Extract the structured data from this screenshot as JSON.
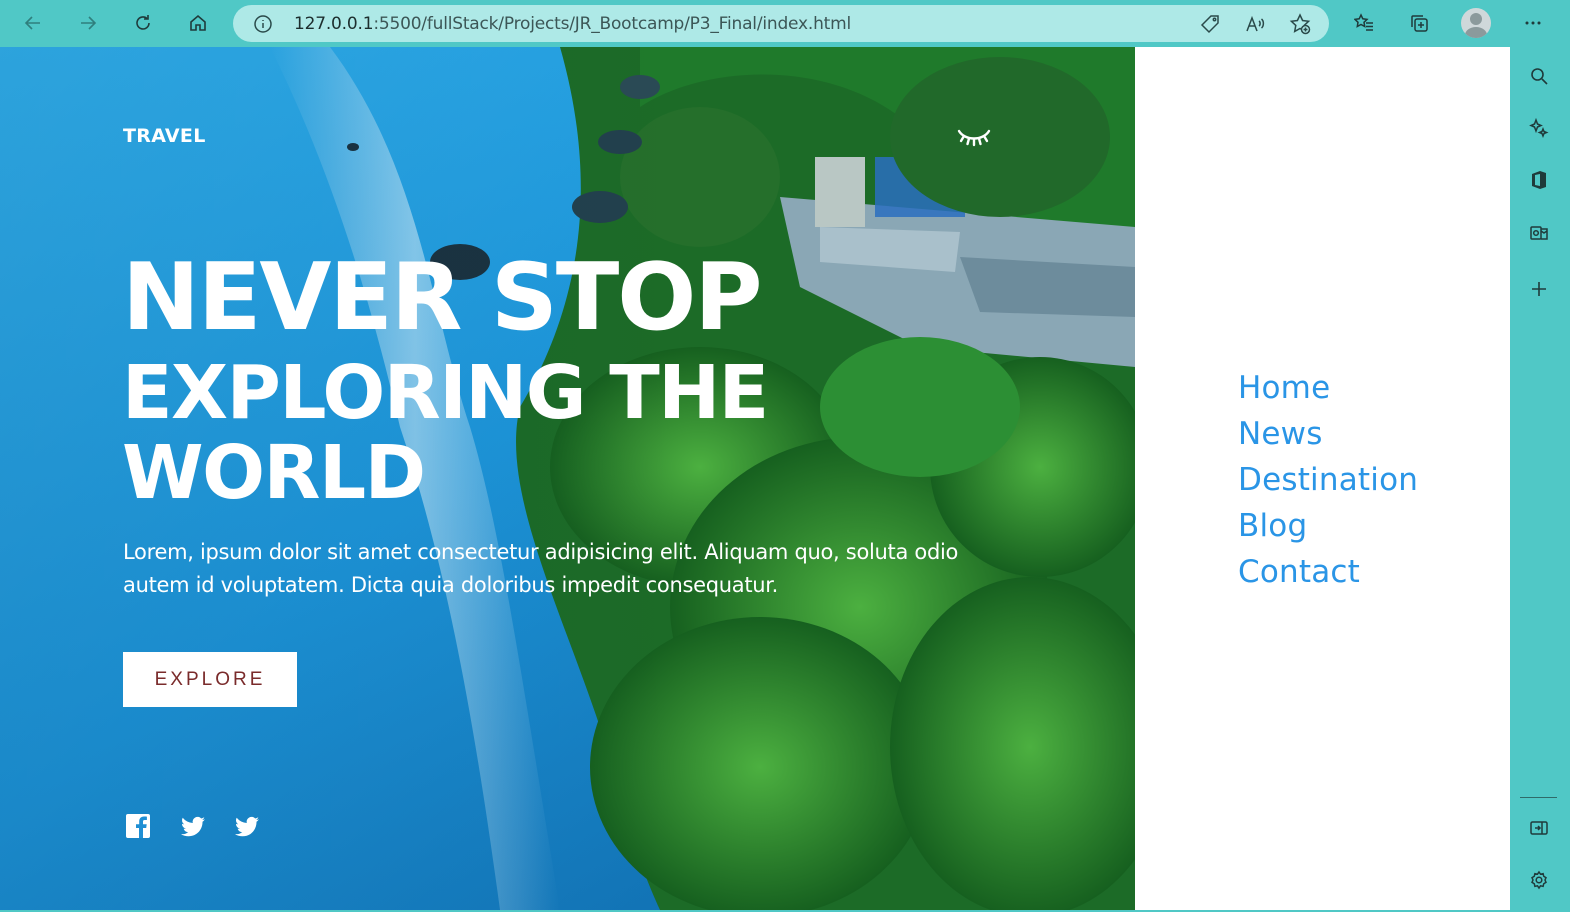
{
  "browser": {
    "url_host": "127.0.0.1",
    "url_path": ":5500/fullStack/Projects/JR_Bootcamp/P3_Final/index.html",
    "icons": [
      "back-icon",
      "forward-icon",
      "refresh-icon",
      "home-icon",
      "info-icon",
      "tag-icon",
      "read-aloud-icon",
      "add-favorite-icon",
      "favorites-icon",
      "collections-icon",
      "profile-icon",
      "more-icon"
    ]
  },
  "sidebar": {
    "icons": [
      "search-icon",
      "copilot-icon",
      "office-icon",
      "outlook-icon",
      "add-icon",
      "split-screen-icon",
      "settings-icon"
    ]
  },
  "page": {
    "brand": "TRAVEL",
    "headline": {
      "line1": "NEVER STOP",
      "line2": "EXPLORING THE",
      "line3": "WORLD"
    },
    "lede": "Lorem, ipsum dolor sit amet consectetur adipisicing elit. Aliquam quo, soluta odio autem id voluptatem. Dicta quia doloribus impedit consequatur.",
    "cta": "EXPLORE",
    "social": [
      "facebook-icon",
      "twitter-icon",
      "twitter-icon"
    ],
    "nav": {
      "items": [
        "Home",
        "News",
        "Destination",
        "Blog",
        "Contact"
      ]
    }
  },
  "colors": {
    "chrome": "#50c8c6",
    "address_bar": "#aee9e7",
    "nav_link": "#2a95e6",
    "cta_text": "#7a2b2b",
    "ocean": "#1f8fd4",
    "forest": "#1f6e2a"
  }
}
